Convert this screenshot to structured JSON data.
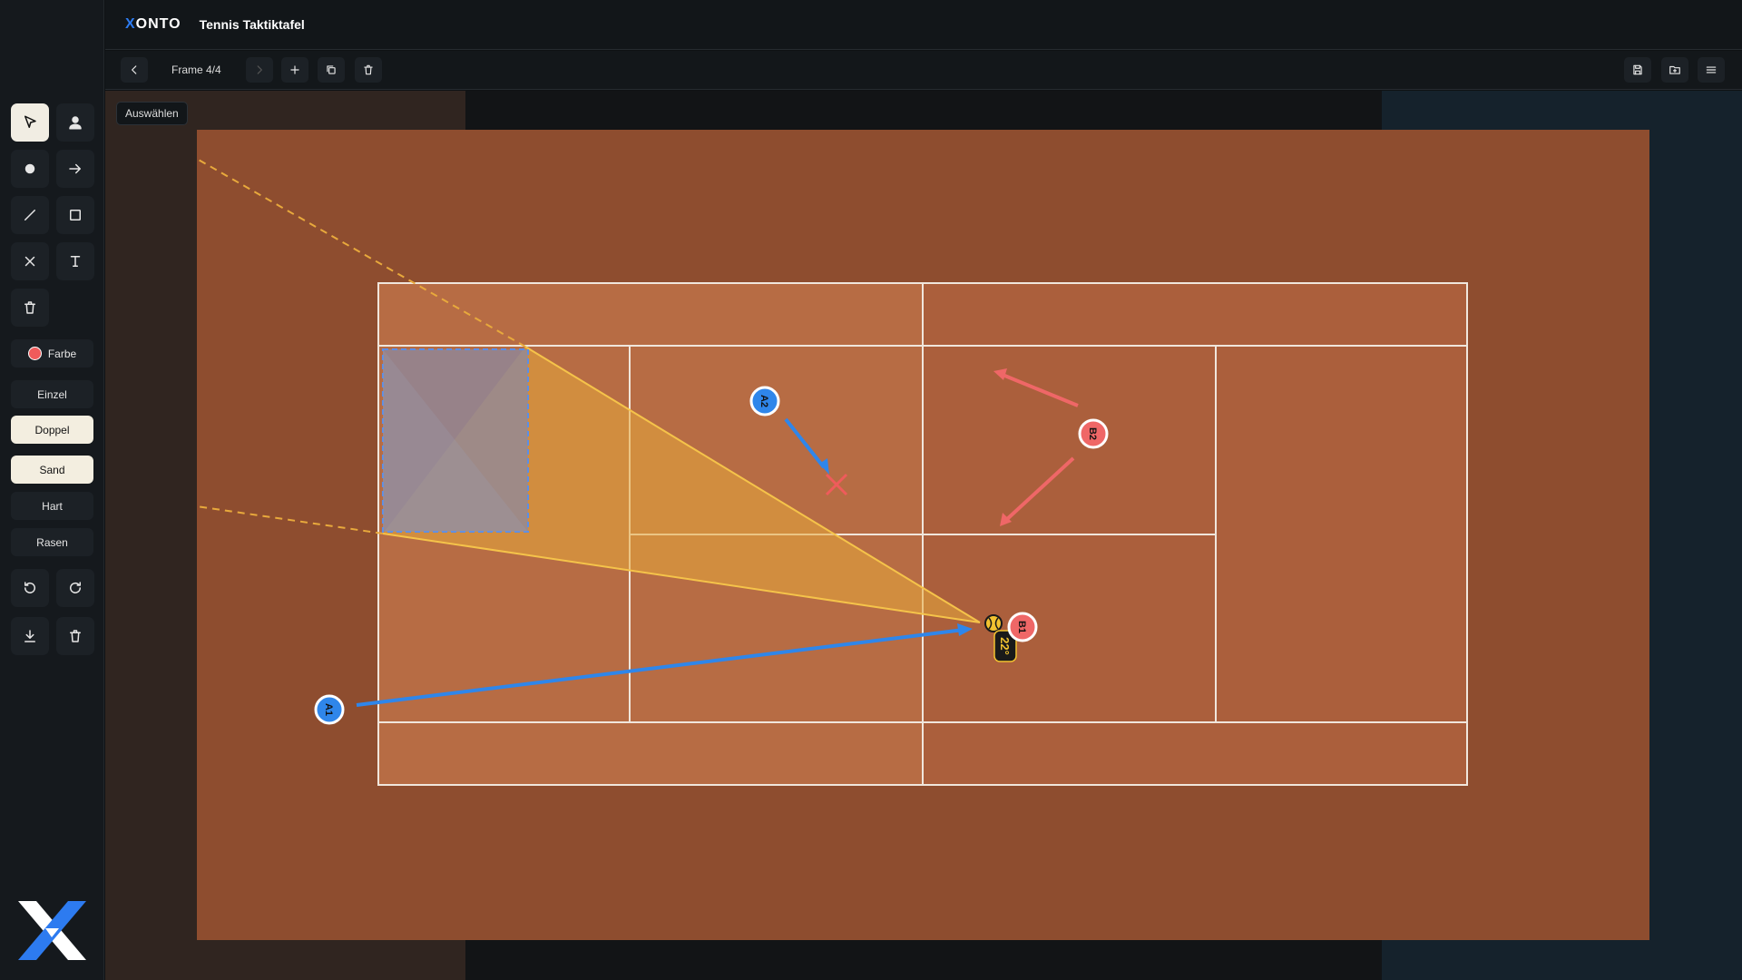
{
  "header": {
    "brand_prefix": "X",
    "brand_rest": "ONTO",
    "title": "Tennis Taktiktafel"
  },
  "toolbar": {
    "frame_label": "Frame 4/4"
  },
  "sidebar": {
    "color_label": "Farbe",
    "modes": [
      "Einzel",
      "Doppel"
    ],
    "surfaces": [
      "Sand",
      "Hart",
      "Rasen"
    ],
    "active_mode": "Doppel",
    "active_surface": "Sand",
    "accent_color": "#ef5b5b"
  },
  "canvas": {
    "tool_tip": "Auswählen"
  },
  "court": {
    "surface_color": "#b56a43",
    "outer_color": "#8e4d2f",
    "players": [
      {
        "label": "A1",
        "team": "blue"
      },
      {
        "label": "A2",
        "team": "blue"
      },
      {
        "label": "B1",
        "team": "red"
      },
      {
        "label": "B2",
        "team": "red"
      }
    ],
    "angle_label": "22°",
    "colors": {
      "blue": "#2f86ea",
      "red": "#ef6767",
      "yellow": "#f2c230"
    }
  }
}
